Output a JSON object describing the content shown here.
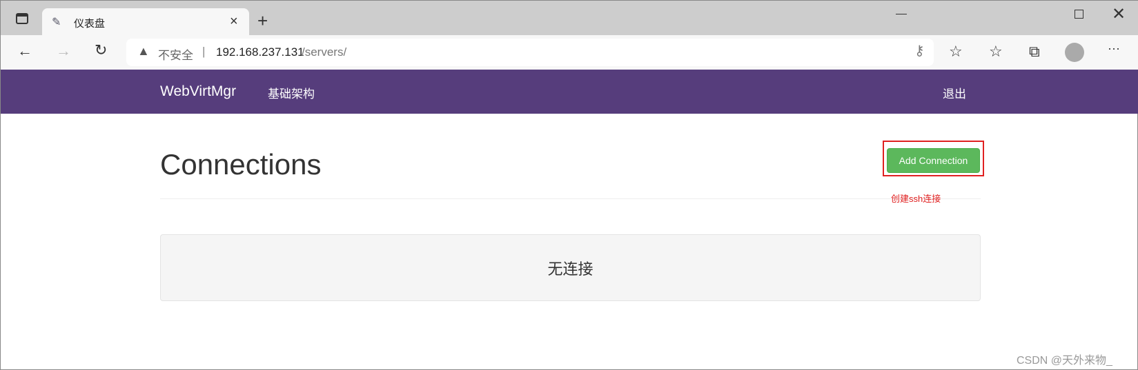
{
  "browser": {
    "tab_title": "仪表盘",
    "security_label": "不安全",
    "url_host": "192.168.237.131",
    "url_path": "/servers/"
  },
  "navbar": {
    "brand": "WebVirtMgr",
    "items": [
      {
        "label": "基础架构"
      }
    ],
    "logout": "退出",
    "color": "#563d7c"
  },
  "main": {
    "title": "Connections",
    "add_button": "Add Connection",
    "empty_text": "无连接",
    "button_color": "#5cb85c"
  },
  "annotation": {
    "text": "创建ssh连接",
    "color": "#e02020"
  },
  "watermark": "CSDN @天外来物_"
}
